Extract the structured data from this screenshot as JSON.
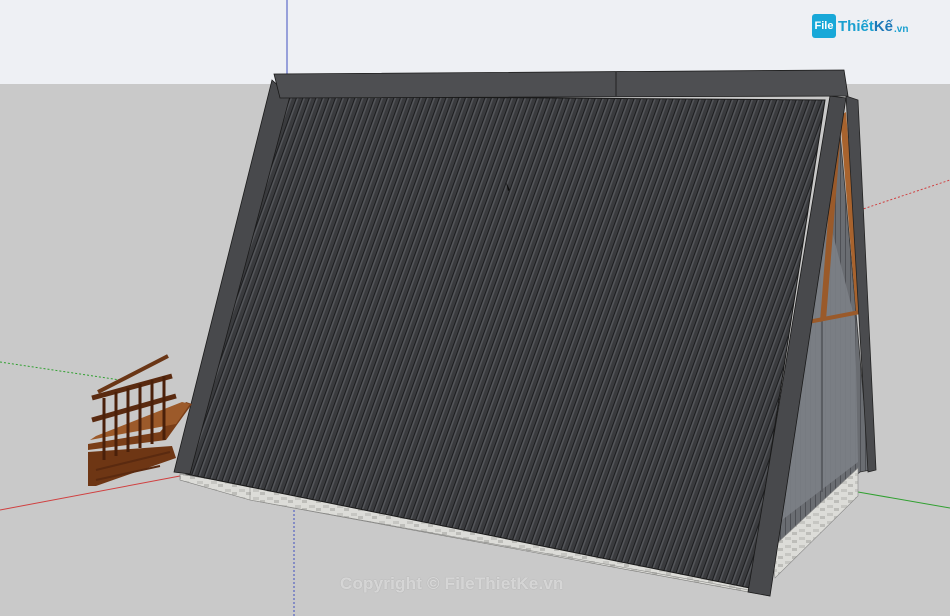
{
  "watermark": {
    "logo_mark": "File",
    "logo_word_a": "Thiết",
    "logo_word_b": "Kế",
    "logo_tld": ".vn",
    "copyright": "Copyright © FileThietKe.vn"
  },
  "colors": {
    "sky": "#eef0f4",
    "ground": "#c9c9c9",
    "roof": "#3c3d40",
    "roof_edge": "#4a4b4e",
    "timber": "#9a5a2a",
    "stone": "#d8d8d4",
    "axis_red": "#d04040",
    "axis_green": "#30a030",
    "axis_blue": "#4050c0"
  },
  "icons": [
    "logo-mark-icon"
  ]
}
